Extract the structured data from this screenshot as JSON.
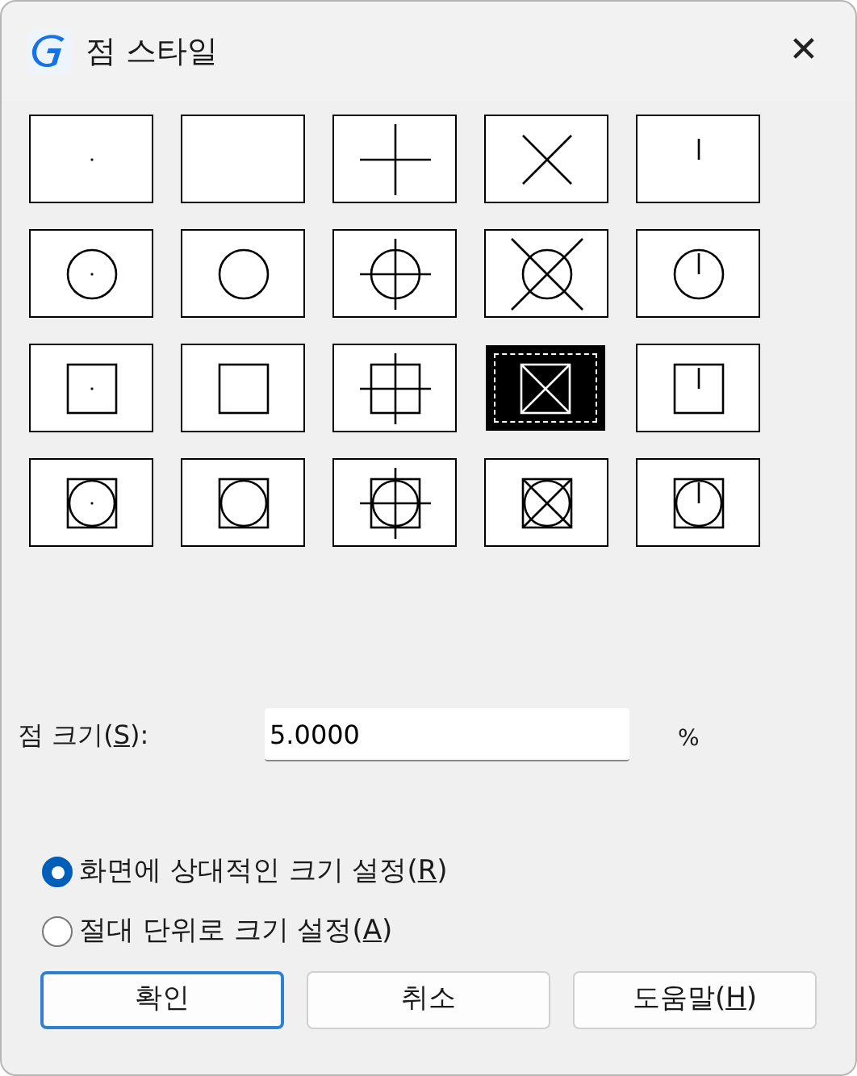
{
  "window": {
    "title": "점 스타일",
    "close": "✕"
  },
  "point_styles": [
    {
      "kind": "dot",
      "selected": false
    },
    {
      "kind": "blank",
      "selected": false
    },
    {
      "kind": "plus",
      "selected": false
    },
    {
      "kind": "cross",
      "selected": false
    },
    {
      "kind": "tick",
      "selected": false
    },
    {
      "kind": "circledot",
      "selected": false
    },
    {
      "kind": "circle",
      "selected": false
    },
    {
      "kind": "circleplus",
      "selected": false
    },
    {
      "kind": "circlecross",
      "selected": false
    },
    {
      "kind": "circletick",
      "selected": false
    },
    {
      "kind": "squaredot",
      "selected": false
    },
    {
      "kind": "square",
      "selected": false
    },
    {
      "kind": "squareplus",
      "selected": false
    },
    {
      "kind": "squarecross",
      "selected": true
    },
    {
      "kind": "squaretick",
      "selected": false
    },
    {
      "kind": "bothdot",
      "selected": false
    },
    {
      "kind": "both",
      "selected": false
    },
    {
      "kind": "bothplus",
      "selected": false
    },
    {
      "kind": "bothcross",
      "selected": false
    },
    {
      "kind": "bothtick",
      "selected": false
    }
  ],
  "point_size": {
    "label": {
      "pre": "점 크기(",
      "key": "S",
      "post": "):"
    },
    "value": "5.0000",
    "unit": "%"
  },
  "size_modes": [
    {
      "label": {
        "pre": "화면에 상대적인 크기 설정(",
        "key": "R",
        "post": ")"
      },
      "selected": true
    },
    {
      "label": {
        "pre": "절대 단위로 크기 설정(",
        "key": "A",
        "post": ")"
      },
      "selected": false
    }
  ],
  "buttons": [
    {
      "label": {
        "pre": "확인"
      },
      "default": true
    },
    {
      "label": {
        "pre": "취소"
      },
      "default": false
    },
    {
      "label": {
        "pre": "도움말(",
        "key": "H",
        "post": ")"
      },
      "default": false
    }
  ]
}
